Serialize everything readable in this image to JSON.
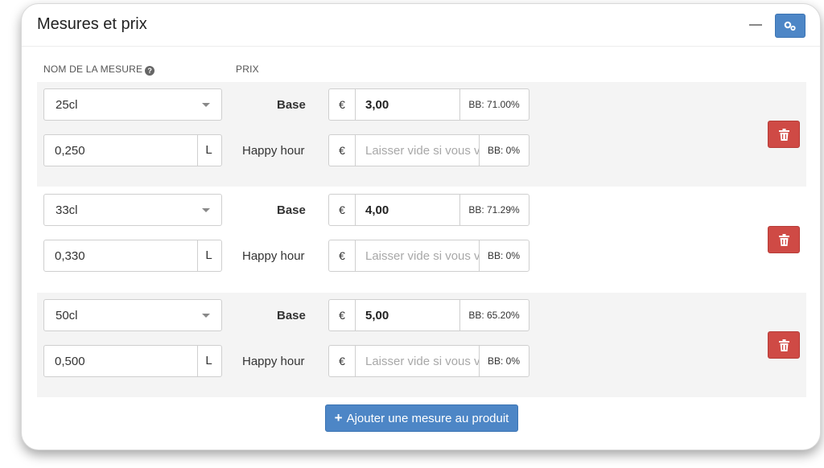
{
  "panel": {
    "title": "Mesures et prix",
    "minimize_icon": "minus-icon",
    "settings_icon": "gears-icon"
  },
  "columns": {
    "measure_name": "NOM DE LA MESURE",
    "price": "PRIX",
    "help_icon": "question-circle-icon"
  },
  "measures": [
    {
      "name": "25cl",
      "volume": "0,250",
      "unit": "L",
      "base_label": "Base",
      "base_currency": "€",
      "base_price": "3,00",
      "base_bb": "BB: 71.00%",
      "hh_label": "Happy hour",
      "hh_currency": "€",
      "hh_placeholder": "Laisser vide si vous v",
      "hh_bb": "BB: 0%"
    },
    {
      "name": "33cl",
      "volume": "0,330",
      "unit": "L",
      "base_label": "Base",
      "base_currency": "€",
      "base_price": "4,00",
      "base_bb": "BB: 71.29%",
      "hh_label": "Happy hour",
      "hh_currency": "€",
      "hh_placeholder": "Laisser vide si vous v",
      "hh_bb": "BB: 0%"
    },
    {
      "name": "50cl",
      "volume": "0,500",
      "unit": "L",
      "base_label": "Base",
      "base_currency": "€",
      "base_price": "5,00",
      "base_bb": "BB: 65.20%",
      "hh_label": "Happy hour",
      "hh_currency": "€",
      "hh_placeholder": "Laisser vide si vous v",
      "hh_bb": "BB: 0%"
    }
  ],
  "actions": {
    "add_measure": "Ajouter une mesure au produit",
    "delete_icon": "trash-icon"
  },
  "colors": {
    "primary": "#4d86c6",
    "danger": "#cf4a45",
    "group_shade": "#f4f4f4"
  }
}
